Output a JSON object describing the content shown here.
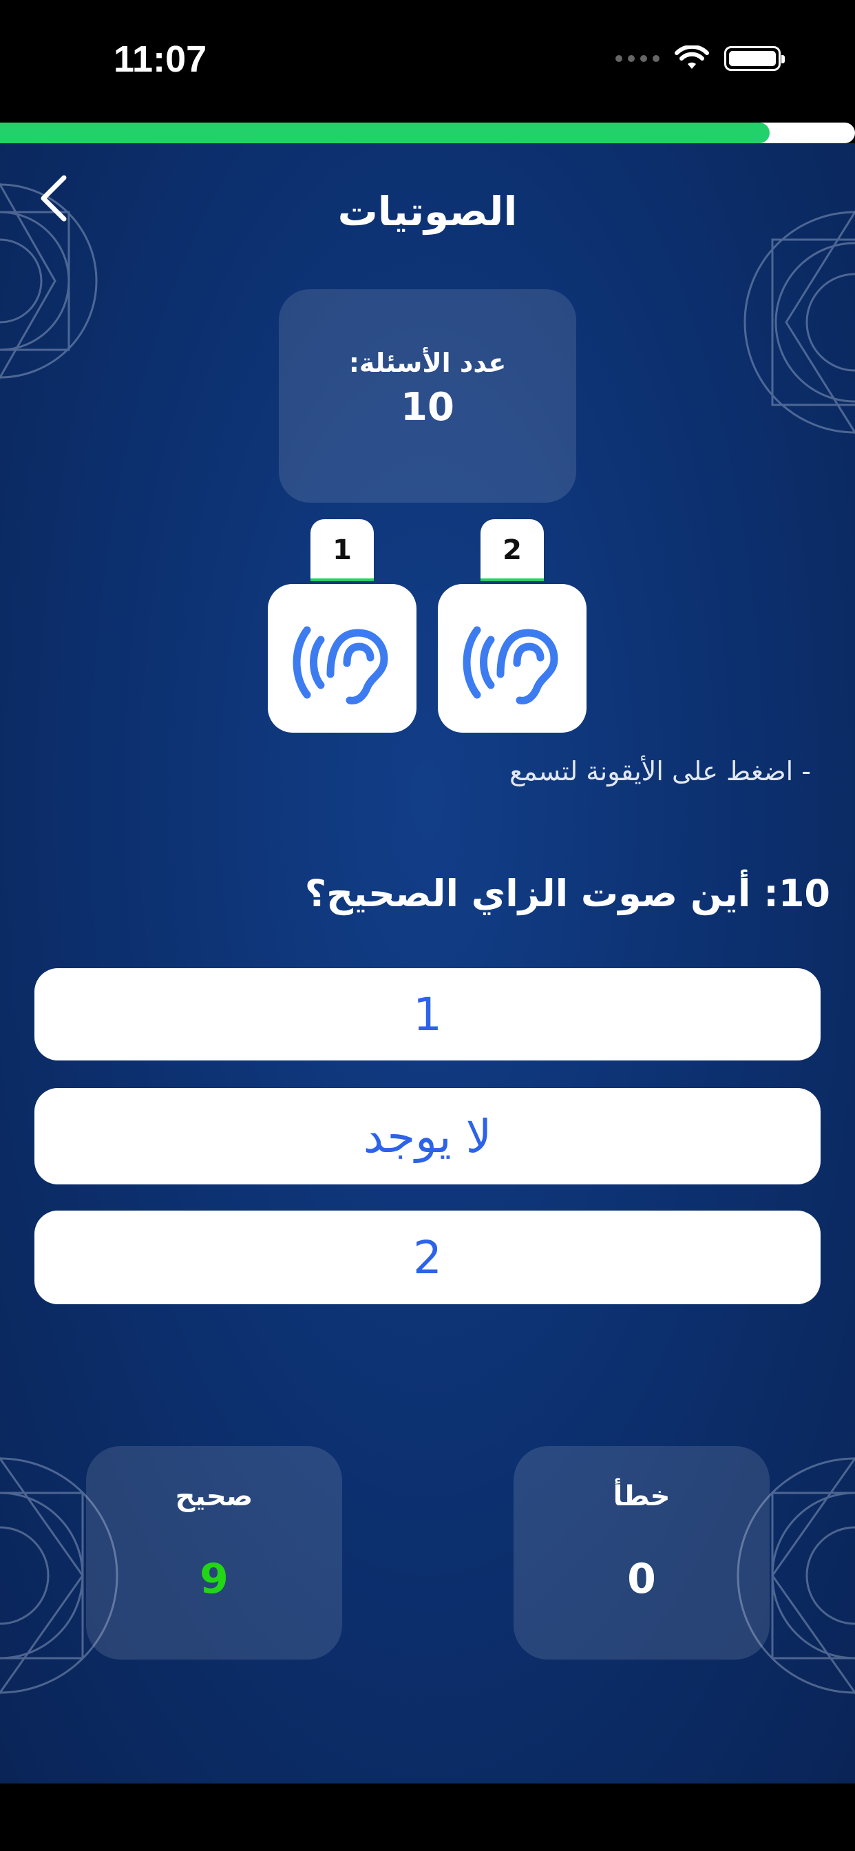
{
  "status_bar": {
    "time": "11:07"
  },
  "progress": {
    "fraction": 0.9,
    "color": "#22d16a"
  },
  "header": {
    "title": "الصوتيات"
  },
  "question_count": {
    "label": "عدد الأسئلة:",
    "value": "10"
  },
  "sounds": [
    {
      "label": "1",
      "icon": "ear-hearing-icon"
    },
    {
      "label": "2",
      "icon": "ear-hearing-icon"
    }
  ],
  "hint": "- اضغط على الأيقونة لتسمع",
  "question": {
    "number": "10:",
    "text": "أين صوت الزاي الصحيح؟"
  },
  "answers": [
    "1",
    "لا يوجد",
    "2"
  ],
  "score": {
    "correct_label": "صحيح",
    "correct_value": "9",
    "wrong_label": "خطأ",
    "wrong_value": "0",
    "correct_color": "#22d616"
  }
}
